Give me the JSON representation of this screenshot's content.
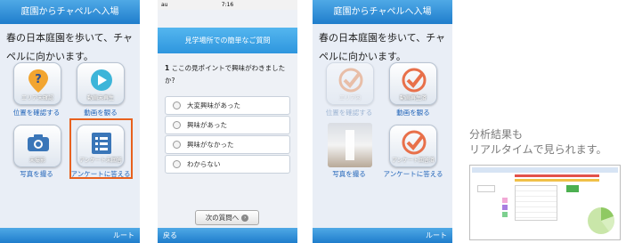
{
  "screen1": {
    "title": "庭園からチャペルへ入場",
    "intro": "春の日本庭園を歩いて、チャペルに向かいます。",
    "buttons": [
      {
        "sub": "エリア未確認",
        "link": "位置を確認する",
        "icon": "location-pin-icon",
        "color": "#f2a530"
      },
      {
        "sub": "動画未再生",
        "link": "動画を観る",
        "icon": "play-icon",
        "color": "#3db5d9"
      },
      {
        "sub": "未撮影",
        "link": "写真を撮る",
        "icon": "camera-icon",
        "color": "#3a76b8"
      },
      {
        "sub": "アンケート未回答",
        "link": "アンケートに答える",
        "icon": "survey-list-icon",
        "color": "#3a76b8"
      }
    ],
    "footer": "ルート",
    "highlight_color": "#e8611e"
  },
  "screen2": {
    "carrier": "au",
    "time": "7:16",
    "title": "見学場所での簡単なご質問",
    "question_number": "1",
    "question": "ここの見ポイントで興味がわきましたか?",
    "options": [
      "大変興味があった",
      "興味があった",
      "興味がなかった",
      "わからない"
    ],
    "next": "次の質問へ",
    "footer": "戻る"
  },
  "screen3": {
    "title": "庭園からチャペルへ入場",
    "intro": "春の日本庭園を歩いて、チャペルに向かいます。",
    "buttons": [
      {
        "sub": "エリア内",
        "link": "位置を確認する",
        "icon": "checkmark-icon"
      },
      {
        "sub": "動画再生済",
        "link": "動画を観る",
        "icon": "checkmark-icon"
      },
      {
        "sub": "",
        "link": "写真を撮る",
        "icon": "chapel-photo"
      },
      {
        "sub": "アンケート回答済",
        "link": "アンケートに答える",
        "icon": "checkmark-icon"
      }
    ],
    "footer": "ルート"
  },
  "caption": {
    "line1": "分析結果も",
    "line2": "リアルタイムで見られます。"
  }
}
